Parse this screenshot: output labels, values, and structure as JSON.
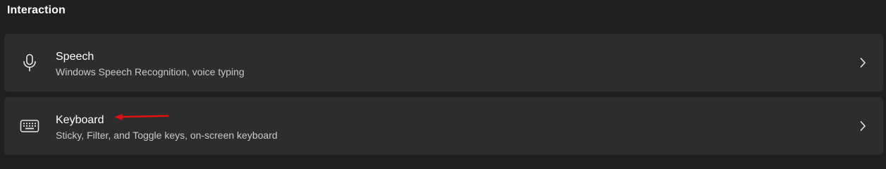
{
  "section": {
    "title": "Interaction"
  },
  "items": [
    {
      "title": "Speech",
      "subtitle": "Windows Speech Recognition, voice typing",
      "icon": "microphone-icon"
    },
    {
      "title": "Keyboard",
      "subtitle": "Sticky, Filter, and Toggle keys, on-screen keyboard",
      "icon": "keyboard-icon"
    }
  ],
  "colors": {
    "background": "#202020",
    "card": "#2d2d2d",
    "annotation_arrow": "#e01010"
  }
}
